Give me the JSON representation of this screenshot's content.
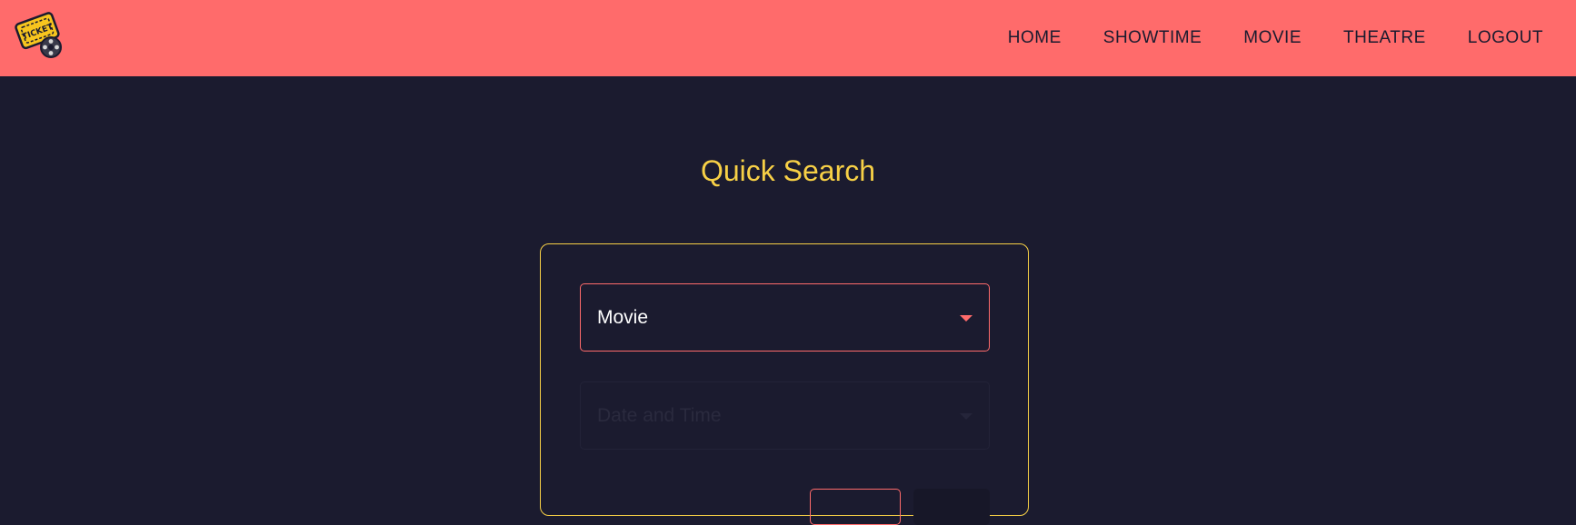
{
  "nav": {
    "logo_text": "TICKET",
    "items": [
      {
        "label": "HOME"
      },
      {
        "label": "SHOWTIME"
      },
      {
        "label": "MOVIE"
      },
      {
        "label": "THEATRE"
      },
      {
        "label": "LOGOUT"
      }
    ]
  },
  "main": {
    "title": "Quick Search",
    "movie_select": {
      "value": "Movie"
    },
    "datetime_select": {
      "placeholder": "Date and Time"
    }
  },
  "colors": {
    "nav_bg": "#ff6b6b",
    "page_bg": "#1b1b2f",
    "accent_yellow": "#f7d046",
    "accent_red": "#ff6b6b"
  }
}
